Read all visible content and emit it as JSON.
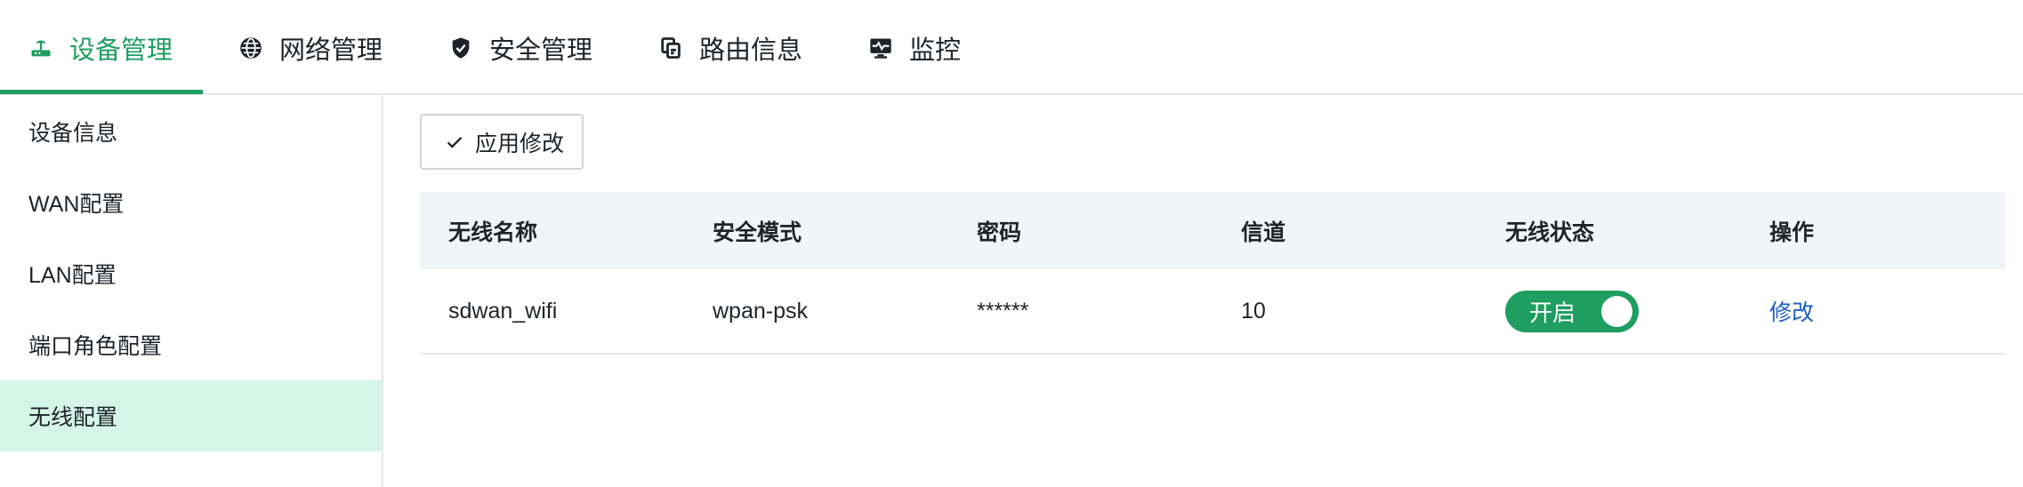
{
  "nav": {
    "tabs": [
      {
        "label": "设备管理",
        "icon": "router-icon"
      },
      {
        "label": "网络管理",
        "icon": "globe-icon"
      },
      {
        "label": "安全管理",
        "icon": "shield-icon"
      },
      {
        "label": "路由信息",
        "icon": "route-copy-icon"
      },
      {
        "label": "监控",
        "icon": "monitor-icon"
      }
    ],
    "active_index": 0
  },
  "sidebar": {
    "items": [
      {
        "label": "设备信息"
      },
      {
        "label": "WAN配置"
      },
      {
        "label": "LAN配置"
      },
      {
        "label": "端口角色配置"
      },
      {
        "label": "无线配置"
      }
    ],
    "active_index": 4
  },
  "toolbar": {
    "apply_label": "应用修改",
    "apply_icon": "check-icon"
  },
  "table": {
    "columns": [
      "无线名称",
      "安全模式",
      "密码",
      "信道",
      "无线状态",
      "操作"
    ],
    "rows": [
      {
        "name": "sdwan_wifi",
        "security": "wpan-psk",
        "password": "******",
        "channel": "10",
        "status_label": "开启",
        "status_on": true,
        "action": "修改"
      }
    ]
  },
  "colors": {
    "accent": "#1e9e61",
    "active_bg": "#d5f5e8",
    "link": "#1a5fc8",
    "header_bg": "#f1f4f8"
  }
}
